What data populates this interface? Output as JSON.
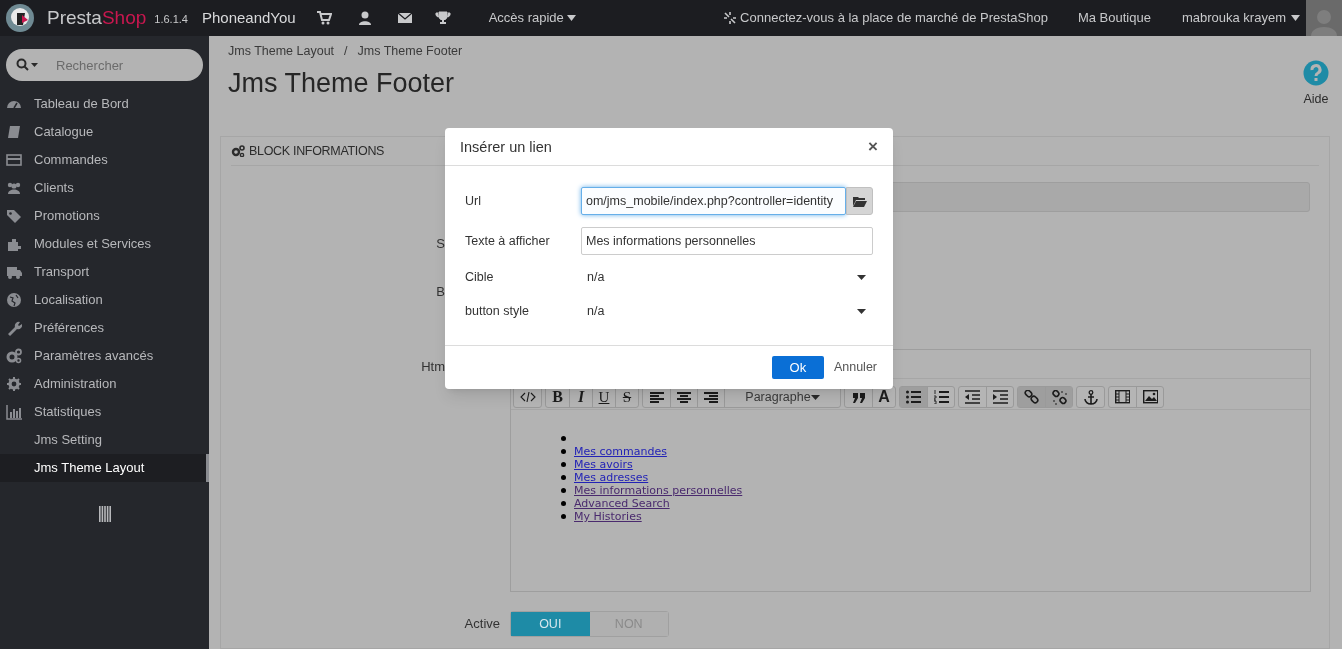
{
  "topbar": {
    "logo_text": [
      "Presta",
      "Shop"
    ],
    "version": "1.6.1.4",
    "shop_name": "PhoneandYou",
    "quick_access": "Accès rapide",
    "marketplace": "Connectez-vous à la place de marché de PrestaShop",
    "shop_link": "Ma Boutique",
    "user": "mabrouka krayem"
  },
  "sidebar": {
    "search": {
      "placeholder": "Rechercher"
    },
    "items": [
      {
        "label": "Tableau de Bord",
        "kind": "section",
        "selected": false
      },
      {
        "label": "Catalogue",
        "kind": "section",
        "selected": false
      },
      {
        "label": "Commandes",
        "kind": "section",
        "selected": false
      },
      {
        "label": "Clients",
        "kind": "section",
        "selected": false
      },
      {
        "label": "Promotions",
        "kind": "section",
        "selected": false
      },
      {
        "label": "Modules et Services",
        "kind": "section",
        "selected": false
      },
      {
        "label": "Transport",
        "kind": "section",
        "selected": false
      },
      {
        "label": "Localisation",
        "kind": "section",
        "selected": false
      },
      {
        "label": "Préférences",
        "kind": "section",
        "selected": false
      },
      {
        "label": "Paramètres avancés",
        "kind": "section",
        "selected": false
      },
      {
        "label": "Administration",
        "kind": "section",
        "selected": false
      },
      {
        "label": "Statistiques",
        "kind": "section",
        "selected": false
      },
      {
        "label": "Jms Setting",
        "kind": "module",
        "selected": false
      },
      {
        "label": "Jms Theme Layout",
        "kind": "module",
        "selected": true
      }
    ]
  },
  "breadcrumb": {
    "separator": "/",
    "items": [
      "Jms Theme Layout",
      "Jms Theme Footer"
    ]
  },
  "page_title": "Jms Theme Footer",
  "help": "Aide",
  "panel": {
    "title": "BLOCK INFORMATIONS",
    "labels": [
      "S",
      "B",
      "Htm"
    ],
    "toolbar": [
      [
        {
          "kind": "code"
        }
      ],
      [
        {
          "kind": "bold",
          "text": "B"
        },
        {
          "kind": "italic",
          "text": "I"
        },
        {
          "kind": "underline",
          "text": "U"
        },
        {
          "kind": "strike",
          "text": "S"
        }
      ],
      [
        {
          "kind": "align-left"
        },
        {
          "kind": "align-center"
        },
        {
          "kind": "align-right"
        },
        {
          "kind": "select",
          "text": "Paragraphe"
        }
      ],
      [
        {
          "kind": "quote"
        },
        {
          "kind": "color",
          "text": "A"
        }
      ],
      [
        {
          "kind": "bullets",
          "active": true
        },
        {
          "kind": "numbers",
          "active": false
        }
      ],
      [
        {
          "kind": "outdent"
        },
        {
          "kind": "indent"
        }
      ],
      [
        {
          "kind": "link",
          "active": true
        },
        {
          "kind": "unlink",
          "active": true
        }
      ],
      [
        {
          "kind": "anchor"
        }
      ],
      [
        {
          "kind": "film"
        },
        {
          "kind": "image"
        }
      ]
    ],
    "editor_items": [
      {
        "text": "Mes commandes",
        "visited": false
      },
      {
        "text": "Mes avoirs",
        "visited": false
      },
      {
        "text": "Mes adresses",
        "visited": false
      },
      {
        "text": "Mes informations personnelles",
        "visited": true
      },
      {
        "text": "Advanced Search",
        "visited": true
      },
      {
        "text": "My Histories",
        "visited": true
      }
    ],
    "active": {
      "label": "Active",
      "options": [
        {
          "label": "OUI",
          "selected": true
        },
        {
          "label": "NON",
          "selected": false
        }
      ]
    }
  },
  "dialog": {
    "title": "Insérer un lien",
    "close": "×",
    "fields": [
      {
        "label": "Url",
        "kind": "browse",
        "value": "om/jms_mobile/index.php?controller=identity",
        "focused": true
      },
      {
        "label": "Texte à afficher",
        "kind": "text",
        "value": "Mes informations personnelles",
        "focused": false
      },
      {
        "label": "Cible",
        "kind": "select",
        "value": "n/a"
      },
      {
        "label": "button style",
        "kind": "select",
        "value": "n/a"
      }
    ],
    "buttons": [
      {
        "label": "Ok",
        "primary": true
      },
      {
        "label": "Annuler",
        "primary": false
      }
    ]
  }
}
